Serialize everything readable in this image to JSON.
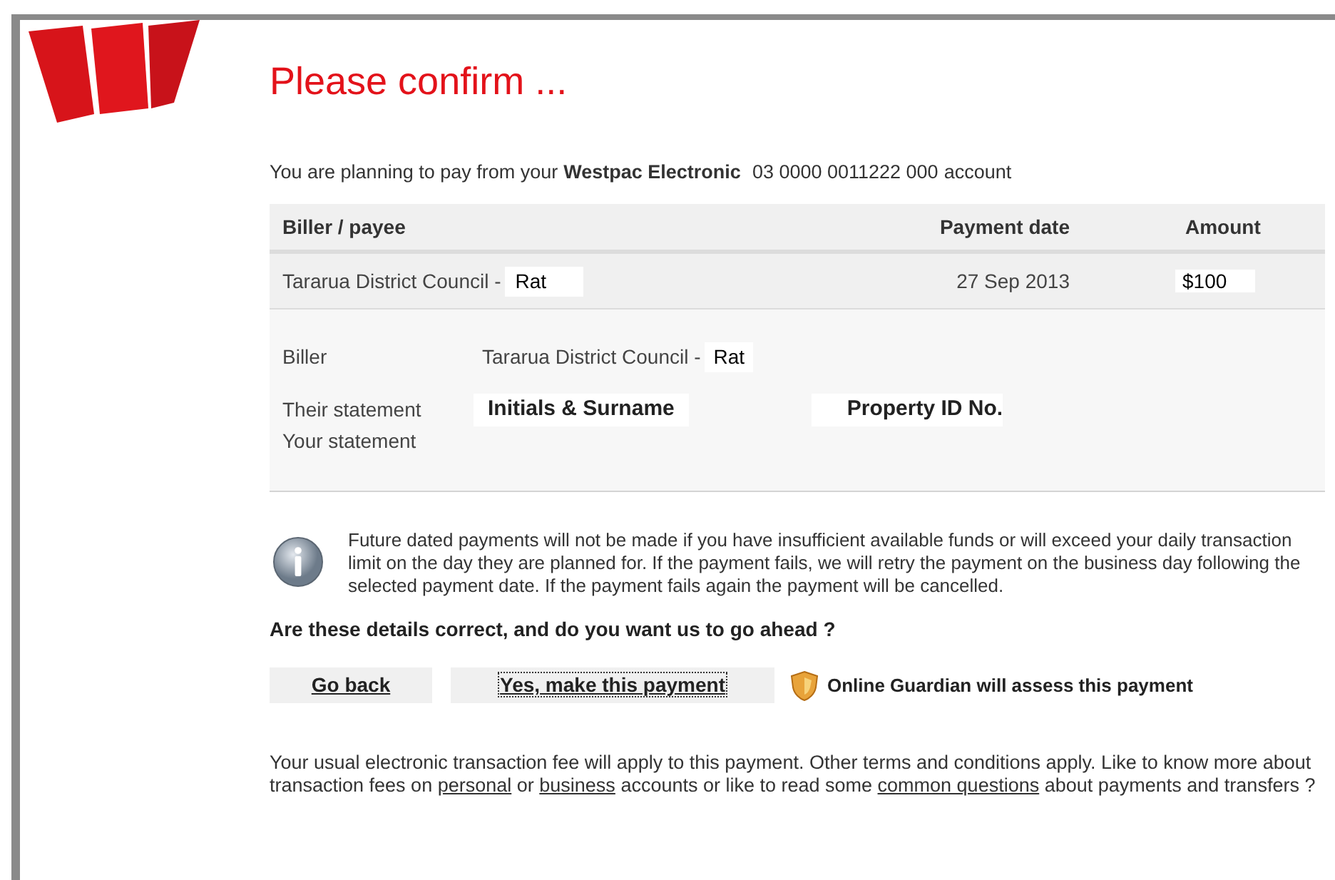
{
  "title": "Please confirm ...",
  "account_line": {
    "prefix": "You are planning to pay from your",
    "account_name": "Westpac Electronic",
    "account_number": "03 0000 0011222 000",
    "suffix": "account"
  },
  "table": {
    "columns": [
      "Biller / payee",
      "Payment date",
      "Amount"
    ],
    "rows": [
      {
        "payee": "Tararua District Council -",
        "payee_suffix": "Rat",
        "date": "27 Sep 2013",
        "amount": "$100"
      }
    ]
  },
  "details": {
    "biller_label": "Biller",
    "biller": "Tararua District Council -",
    "biller_suffix": "Rat",
    "their_label": "Their statement",
    "their_values": [
      "Initials & Surname",
      "Property ID No."
    ],
    "your_label": "Your statement"
  },
  "notice": "Future dated payments will not be made if you have insufficient available funds or will exceed your daily transaction limit on the day they are planned for. If the payment fails, we will retry the payment on the business day following the selected payment date. If the payment fails again the payment will be cancelled.",
  "question": "Are these details correct, and do you want us to go ahead ?",
  "buttons": [
    {
      "label": "Go back",
      "focused": false
    },
    {
      "label": "Yes, make this payment",
      "focused": true
    }
  ],
  "guardian": "Online Guardian will assess this payment",
  "footer": [
    {
      "kind": "text",
      "text": "Your usual electronic transaction fee will apply to this payment. Other terms and conditions apply. Like to know more about transaction fees on "
    },
    {
      "kind": "link",
      "text": "personal"
    },
    {
      "kind": "text",
      "text": " or "
    },
    {
      "kind": "link",
      "text": "business"
    },
    {
      "kind": "text",
      "text": " accounts or like to read some "
    },
    {
      "kind": "link",
      "text": "common questions"
    },
    {
      "kind": "text",
      "text": " about payments and transfers ?"
    }
  ]
}
